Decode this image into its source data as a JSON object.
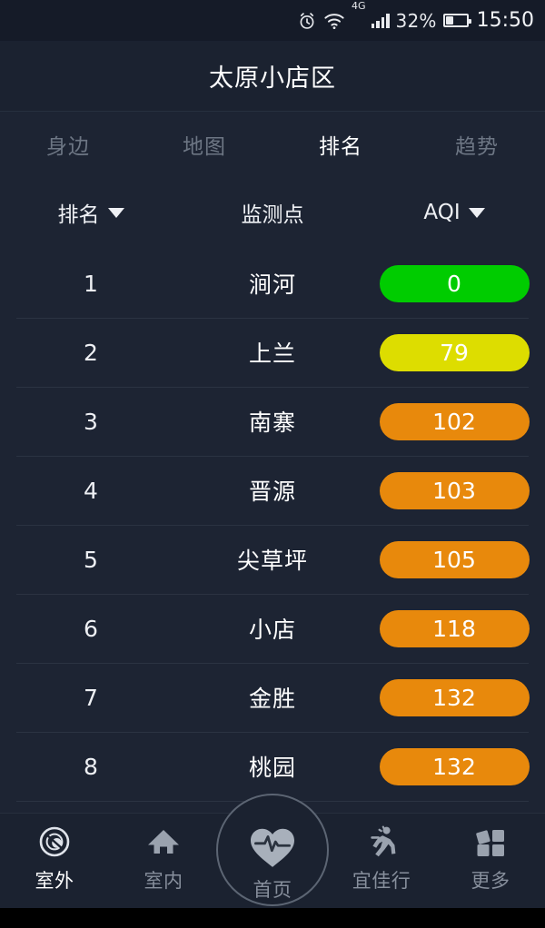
{
  "statusbar": {
    "alarm_icon": "alarm-clock-icon",
    "wifi_icon": "wifi-icon",
    "network_type": "4G",
    "signal_icon": "cellular-signal-icon",
    "battery_percent": "32%",
    "battery_icon": "battery-icon",
    "time": "15:50"
  },
  "header": {
    "title": "太原小店区"
  },
  "tabs": [
    {
      "label": "身边",
      "active": false
    },
    {
      "label": "地图",
      "active": false
    },
    {
      "label": "排名",
      "active": true
    },
    {
      "label": "趋势",
      "active": false
    }
  ],
  "columns": {
    "rank": "排名",
    "site": "监测点",
    "aqi": "AQI",
    "sort_icon": "caret-down-icon"
  },
  "colors": {
    "good": "#00cc00",
    "moderate": "#dddd00",
    "unhealthy_sensitive": "#e8890c",
    "background": "#1d2433",
    "header_background": "#1b2230",
    "accent_text": "#ffffff",
    "muted_text": "#6d7684"
  },
  "rows": [
    {
      "rank": "1",
      "site": "涧河",
      "aqi": "0",
      "color": "#00cc00"
    },
    {
      "rank": "2",
      "site": "上兰",
      "aqi": "79",
      "color": "#dddd00"
    },
    {
      "rank": "3",
      "site": "南寨",
      "aqi": "102",
      "color": "#e8890c"
    },
    {
      "rank": "4",
      "site": "晋源",
      "aqi": "103",
      "color": "#e8890c"
    },
    {
      "rank": "5",
      "site": "尖草坪",
      "aqi": "105",
      "color": "#e8890c"
    },
    {
      "rank": "6",
      "site": "小店",
      "aqi": "118",
      "color": "#e8890c"
    },
    {
      "rank": "7",
      "site": "金胜",
      "aqi": "132",
      "color": "#e8890c"
    },
    {
      "rank": "8",
      "site": "桃园",
      "aqi": "132",
      "color": "#e8890c"
    }
  ],
  "bottomnav": [
    {
      "label": "室外",
      "icon": "outdoor-orbit-icon",
      "active": true
    },
    {
      "label": "室内",
      "icon": "home-icon",
      "active": false
    },
    {
      "label": "首页",
      "icon": "heartbeat-icon",
      "active": false
    },
    {
      "label": "宜佳行",
      "icon": "running-person-icon",
      "active": false
    },
    {
      "label": "更多",
      "icon": "grid-more-icon",
      "active": false
    }
  ]
}
